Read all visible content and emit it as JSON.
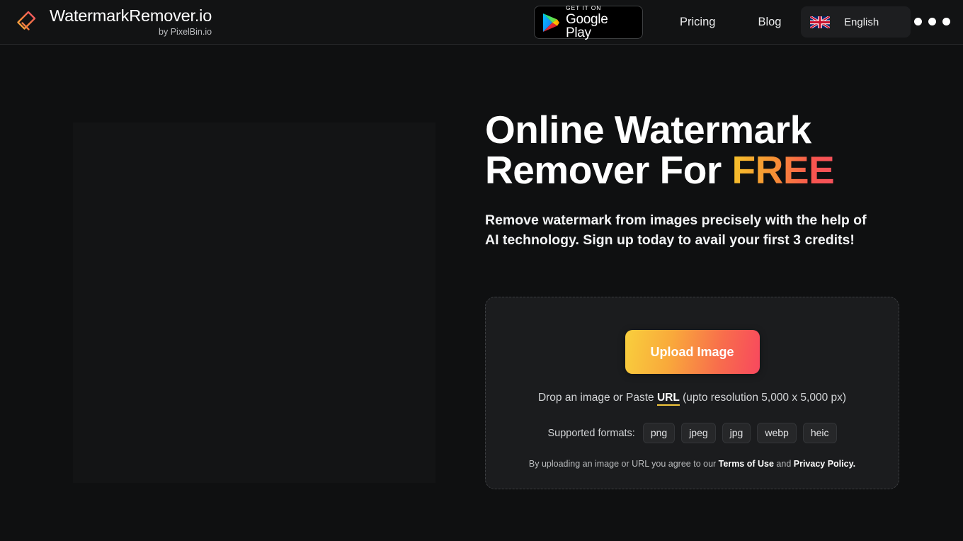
{
  "header": {
    "brand": {
      "icon": "eraser-logo-icon",
      "title": "WatermarkRemover.io",
      "subtitle": "by PixelBin.io"
    },
    "google_play": {
      "icon": "google-play-triangle-icon",
      "small_label": "GET IT ON",
      "big_label": "Google Play"
    },
    "nav": [
      {
        "label": "Pricing"
      },
      {
        "label": "Blog"
      }
    ],
    "language": {
      "icon": "uk-flag-icon",
      "value": "English"
    },
    "menu_dots": {
      "icon": "three-dots-icon",
      "count": 3
    },
    "colors": {
      "bar_bg": "#121314",
      "border": "#2a2b2d"
    }
  },
  "hero": {
    "title_line1": "Online Watermark",
    "title_line2_prefix": "Remover For ",
    "title_line2_accent": "FREE",
    "subtitle": "Remove watermark from images precisely with the help of AI technology. Sign up today to avail your first 3 credits!",
    "media_placeholder": {
      "icon": "image-placeholder",
      "color": "#131415"
    },
    "colors": {
      "accent_gradient_start": "#f5c22b",
      "accent_gradient_end": "#f6515c"
    }
  },
  "upload_card": {
    "button_label": "Upload Image",
    "drop_text_before": "Drop an image or Paste ",
    "drop_url_label": "URL",
    "drop_text_after": " (upto resolution 5,000 x 5,000 px)",
    "formats_label": "Supported formats:",
    "formats": [
      "png",
      "jpeg",
      "jpg",
      "webp",
      "heic"
    ],
    "terms_before": "By uploading an image or URL you agree to our ",
    "terms_of_use": "Terms of Use",
    "terms_middle": " and ",
    "privacy_policy": "Privacy Policy.",
    "colors": {
      "card_bg": "#1b1c1e",
      "card_border": "#3c3e41",
      "button_gradient_start": "#f9cf3d",
      "button_gradient_end": "#f8485e",
      "url_underline": "#f3c73c"
    }
  }
}
